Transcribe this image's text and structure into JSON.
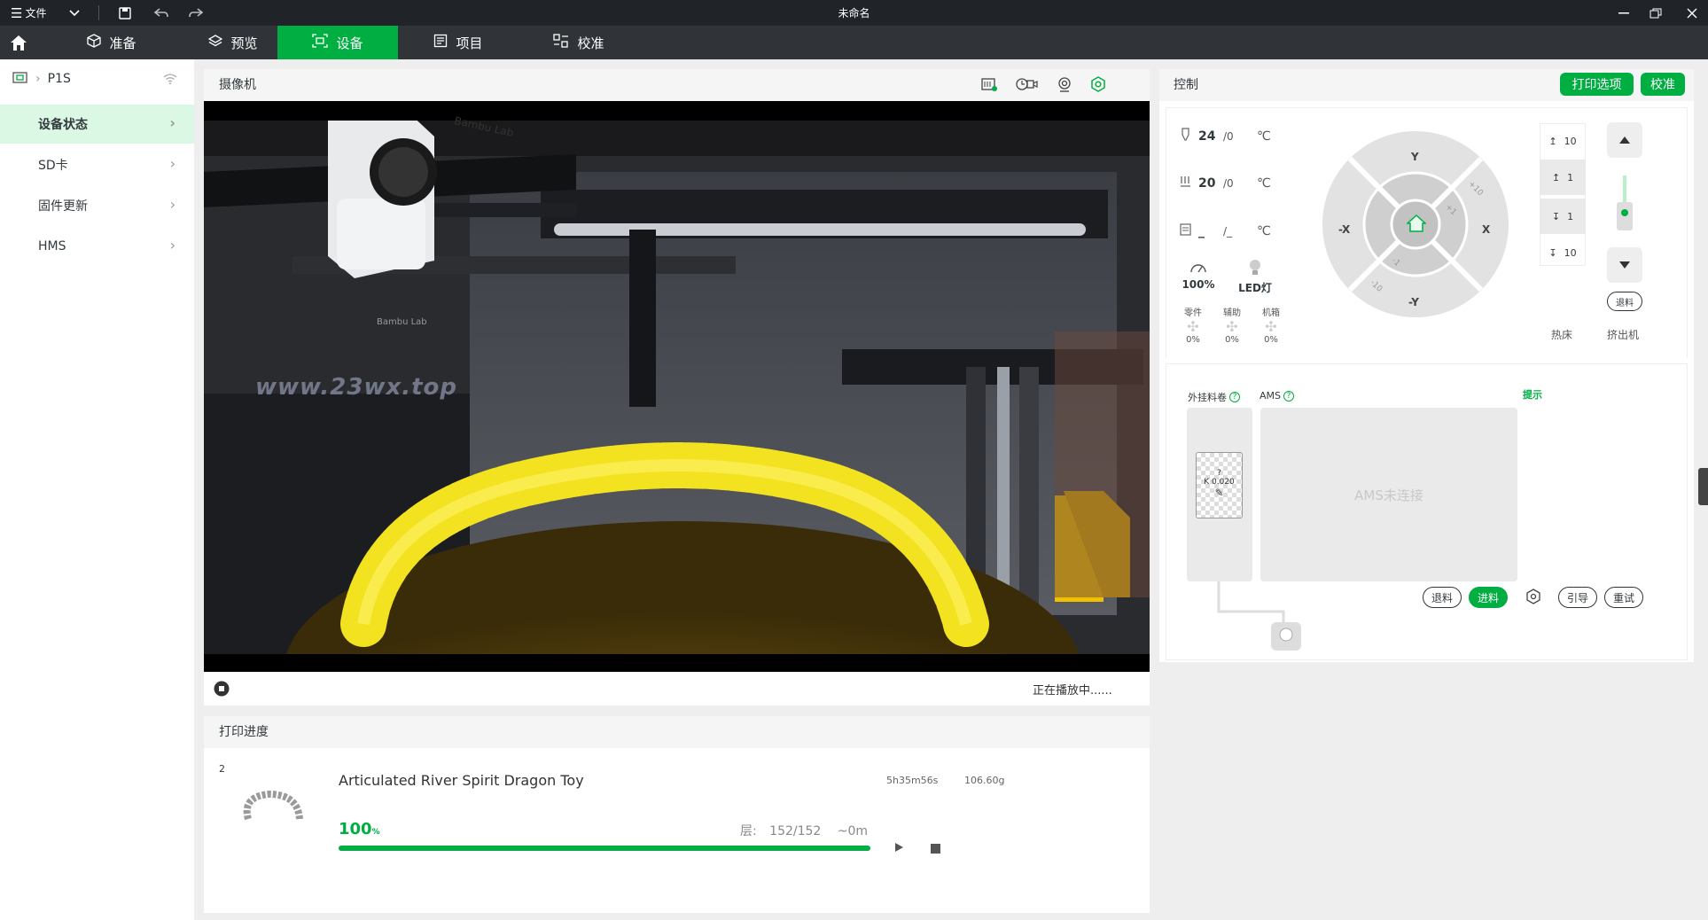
{
  "titlebar": {
    "file_menu": "文件",
    "title": "未命名"
  },
  "nav": {
    "tabs": [
      {
        "label": "准备",
        "icon": "cube-icon"
      },
      {
        "label": "预览",
        "icon": "layers-icon"
      },
      {
        "label": "设备",
        "icon": "device-icon",
        "active": true
      },
      {
        "label": "项目",
        "icon": "project-icon"
      },
      {
        "label": "校准",
        "icon": "calibration-icon"
      }
    ]
  },
  "sidebar": {
    "printer_name": "P1S",
    "items": [
      {
        "label": "设备状态",
        "active": true
      },
      {
        "label": "SD卡"
      },
      {
        "label": "固件更新"
      },
      {
        "label": "HMS"
      }
    ]
  },
  "camera": {
    "title": "摄像机",
    "watermark": "www.23wx.top",
    "box_logo": "Bambu Lab",
    "nozzle_logo": "Bambu Lab",
    "status": "正在播放中......"
  },
  "progress": {
    "title": "打印进度",
    "plate_number": "2",
    "job_name": "Articulated River Spirit Dragon Toy",
    "time": "5h35m56s",
    "weight": "106.60g",
    "percent_value": "100",
    "percent_unit": "%",
    "percent_fraction": 1.0,
    "layer_label": "层:",
    "layers": "152/152",
    "remaining": "~0m"
  },
  "control": {
    "title": "控制",
    "print_options_button": "打印选项",
    "calibrate_button": "校准",
    "nozzle_temp": "24",
    "nozzle_target": "/0",
    "bed_temp": "20",
    "bed_target": "/0",
    "chamber_temp": "_",
    "chamber_target": "/_",
    "temp_unit": "℃",
    "speed": "100%",
    "led_label": "LED灯",
    "fans": [
      {
        "label": "零件",
        "value": "0%"
      },
      {
        "label": "辅助",
        "value": "0%"
      },
      {
        "label": "机箱",
        "value": "0%"
      }
    ],
    "jog": {
      "y_plus": "Y",
      "y_minus": "-Y",
      "x_plus": "X",
      "x_minus": "-X",
      "plus10": "+10",
      "plus1": "+1",
      "minus1": "-1",
      "minus10": "-10"
    },
    "bed_steps": [
      "10",
      "1",
      "1",
      "10"
    ],
    "bed_label": "热床",
    "extruder_label": "挤出机",
    "extruder_retract": "退料"
  },
  "ams": {
    "external_spool_label": "外挂料卷",
    "ams_label": "AMS",
    "hint_label": "提示",
    "spool_question": "?",
    "spool_k": "K 0.020",
    "not_connected": "AMS未连接",
    "buttons": {
      "unload": "退料",
      "load": "进料",
      "guide": "引导",
      "retry": "重试"
    }
  },
  "colors": {
    "accent": "#00ae42",
    "titlebar": "#202429",
    "navbar": "#303438",
    "active_side": "#dbf8e4"
  }
}
